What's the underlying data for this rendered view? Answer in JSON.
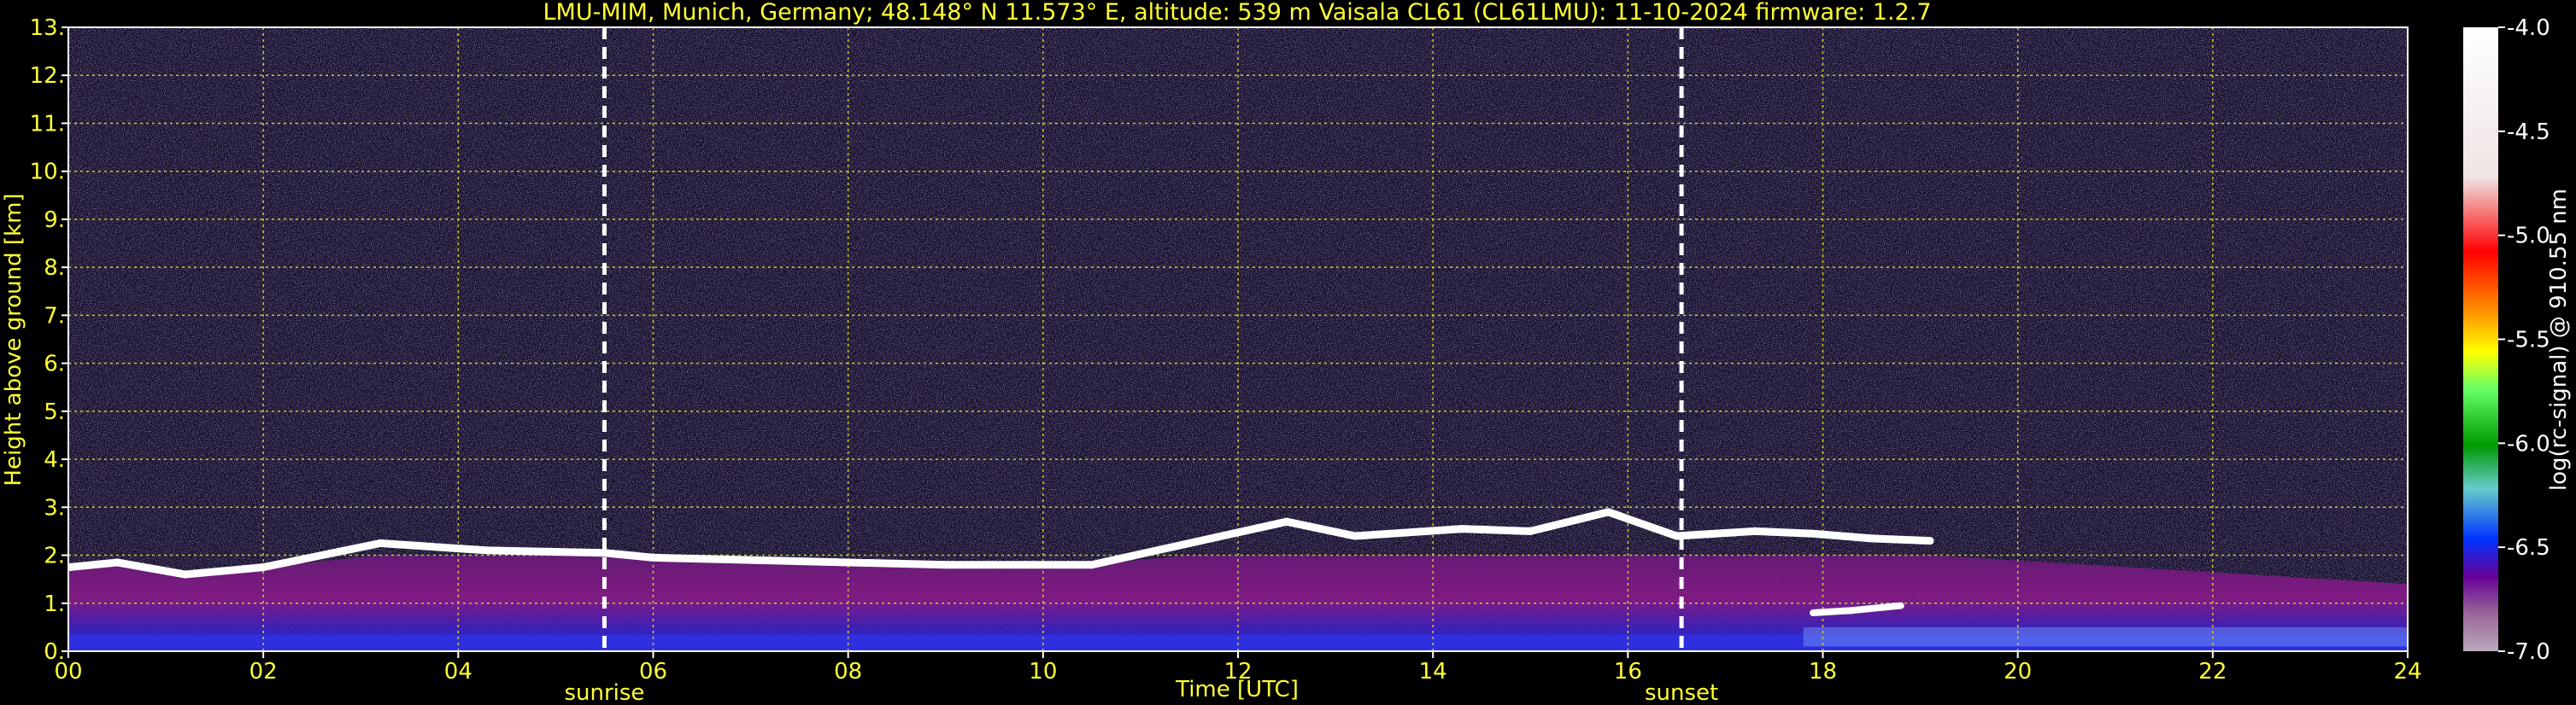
{
  "chart_data": {
    "type": "heatmap",
    "title": "LMU-MIM, Munich, Germany; 48.148° N 11.573° E, altitude: 539 m    Vaisala CL61 (CL61LMU): 11-10-2024    firmware: 1.2.7",
    "xlabel": "Time [UTC]",
    "ylabel": "Height above ground [km]",
    "xlim": [
      0,
      24
    ],
    "ylim": [
      0,
      13
    ],
    "x_ticks": [
      "00",
      "02",
      "04",
      "06",
      "08",
      "10",
      "12",
      "14",
      "16",
      "18",
      "20",
      "22",
      "24"
    ],
    "y_ticks": [
      "0.",
      "1.",
      "2.",
      "3.",
      "4.",
      "5.",
      "6.",
      "7.",
      "8.",
      "9.",
      "10.",
      "11.",
      "12.",
      "13."
    ],
    "grid": true,
    "markers": [
      {
        "label": "sunrise",
        "x": 5.5
      },
      {
        "label": "sunset",
        "x": 16.55
      }
    ],
    "colorbar": {
      "label": "log(rc-signal) @ 910.55 nm",
      "range": [
        -7.0,
        -4.0
      ],
      "ticks": [
        "-4.0",
        "-4.5",
        "-5.0",
        "-5.5",
        "-6.0",
        "-6.5",
        "-7.0"
      ]
    },
    "cloud_base_km": [
      {
        "x": 0.0,
        "y": 1.75
      },
      {
        "x": 0.5,
        "y": 1.85
      },
      {
        "x": 1.2,
        "y": 1.6
      },
      {
        "x": 2.0,
        "y": 1.75
      },
      {
        "x": 3.2,
        "y": 2.25
      },
      {
        "x": 4.3,
        "y": 2.1
      },
      {
        "x": 5.5,
        "y": 2.05
      },
      {
        "x": 6.0,
        "y": 1.95
      },
      {
        "x": 7.0,
        "y": 1.9
      },
      {
        "x": 8.0,
        "y": 1.85
      },
      {
        "x": 9.0,
        "y": 1.8
      },
      {
        "x": 10.5,
        "y": 1.8
      },
      {
        "x": 11.5,
        "y": 2.25
      },
      {
        "x": 12.5,
        "y": 2.7
      },
      {
        "x": 13.2,
        "y": 2.4
      },
      {
        "x": 14.3,
        "y": 2.55
      },
      {
        "x": 15.0,
        "y": 2.5
      },
      {
        "x": 15.8,
        "y": 2.9
      },
      {
        "x": 16.5,
        "y": 2.4
      },
      {
        "x": 17.3,
        "y": 2.5
      },
      {
        "x": 17.9,
        "y": 2.45
      },
      {
        "x": 18.5,
        "y": 2.35
      },
      {
        "x": 19.1,
        "y": 2.3
      }
    ],
    "low_cloud_km": [
      {
        "x": 17.9,
        "y": 0.8
      },
      {
        "x": 18.3,
        "y": 0.85
      },
      {
        "x": 18.8,
        "y": 0.95
      }
    ]
  },
  "colors": {
    "background": "#000000",
    "text": "#ffff33",
    "grid": "#cccc22",
    "noise": "#5a4a8a",
    "boundary_layer": "#7a1a8a",
    "aerosol_low": "#3030e0",
    "cloud": "#ffffff"
  }
}
